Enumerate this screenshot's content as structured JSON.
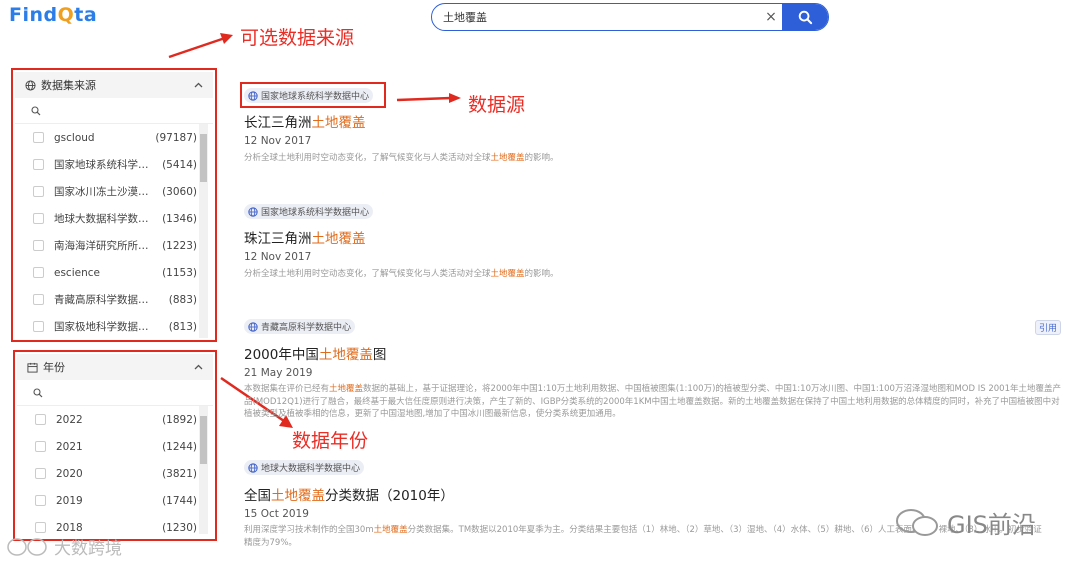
{
  "logo": {
    "part1": "Find",
    "part2": "Q",
    "part3": "ta"
  },
  "search": {
    "value": "土地覆盖",
    "clear": "×"
  },
  "callouts": {
    "sources": "可选数据来源",
    "source": "数据源",
    "year": "数据年份"
  },
  "panels": {
    "sources": {
      "title": "数据集来源",
      "items": [
        {
          "label": "gscloud",
          "count": "(97187)"
        },
        {
          "label": "国家地球系统科学数据...",
          "count": "(5414)"
        },
        {
          "label": "国家冰川冻土沙漠科学...",
          "count": "(3060)"
        },
        {
          "label": "地球大数据科学数据中心",
          "count": "(1346)"
        },
        {
          "label": "南海海洋研究所所级中心",
          "count": "(1223)"
        },
        {
          "label": "escience",
          "count": "(1153)"
        },
        {
          "label": "青藏高原科学数据中心",
          "count": "(883)"
        },
        {
          "label": "国家极地科学数据中心",
          "count": "(813)"
        }
      ]
    },
    "years": {
      "title": "年份",
      "items": [
        {
          "label": "2022",
          "count": "(1892)"
        },
        {
          "label": "2021",
          "count": "(1244)"
        },
        {
          "label": "2020",
          "count": "(3821)"
        },
        {
          "label": "2019",
          "count": "(1744)"
        },
        {
          "label": "2018",
          "count": "(1230)"
        }
      ]
    }
  },
  "results": [
    {
      "source": "国家地球系统科学数据中心",
      "title_pre": "长江三角洲",
      "title_hl": "土地覆盖",
      "title_post": "",
      "date": "12 Nov 2017",
      "desc_pre": "分析全球土地利用时空动态变化，了解气候变化与人类活动对全球",
      "desc_hl": "土地覆盖",
      "desc_post": "的影响。"
    },
    {
      "source": "国家地球系统科学数据中心",
      "title_pre": "珠江三角洲",
      "title_hl": "土地覆盖",
      "title_post": "",
      "date": "12 Nov 2017",
      "desc_pre": "分析全球土地利用时空动态变化，了解气候变化与人类活动对全球",
      "desc_hl": "土地覆盖",
      "desc_post": "的影响。"
    },
    {
      "source": "青藏高原科学数据中心",
      "cite": "引用",
      "title_pre": "2000年中国",
      "title_hl": "土地覆盖",
      "title_post": "图",
      "date": "21 May 2019",
      "desc_pre": "本数据集在评价已经有",
      "desc_hl": "土地覆盖",
      "desc_post": "数据的基础上，基于证据理论，将2000年中国1:10万土地利用数据、中国植被图集(1:100万)的植被型分类、中国1:10万冰川图、中国1:100万沼泽湿地图和MOD IS 2001年土地覆盖产品(MOD12Q1)进行了融合，最终基于最大信任度原则进行决策，产生了新的、IGBP分类系统的2000年1KM中国土地覆盖数据。新的土地覆盖数据在保持了中国土地利用数据的总体精度的同时，补充了中国植被图中对植被类型及植被季相的信息，更新了中国湿地图,增加了中国冰川图最新信息，使分类系统更加通用。"
    },
    {
      "source": "地球大数据科学数据中心",
      "title_pre": "全国",
      "title_hl": "土地覆盖",
      "title_post": "分类数据（2010年）",
      "date": "15 Oct 2019",
      "desc_pre": "利用深度学习技术制作的全国30m",
      "desc_hl": "土地覆盖",
      "desc_post": "分类数据集。TM数据以2010年夏季为主。分类结果主要包括（1）林地、（2）草地、（3）湿地、（4）水体、（5）耕地、（6）人工表面、（7）裸地、（8）冰川。初步验证精度为79%。"
    }
  ],
  "watermarks": {
    "left": "大数跨境",
    "right": "GIS前沿"
  },
  "colors": {
    "accent": "#2e5fd9",
    "annotation": "#e02a20",
    "highlight": "#e06b1b"
  }
}
